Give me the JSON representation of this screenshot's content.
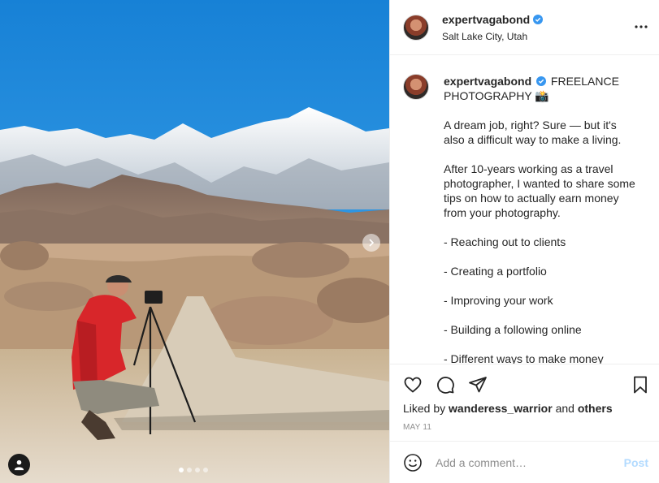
{
  "post": {
    "username": "expertvagabond",
    "location": "Salt Lake City, Utah",
    "verified": true
  },
  "caption": {
    "username": "expertvagabond",
    "title": "FREELANCE PHOTOGRAPHY 📸",
    "paragraphs": [
      "A dream job, right? Sure — but it's also a difficult way to make a living.",
      "After 10-years working as a travel photographer, I wanted to share some tips on how to actually earn money from your photography.",
      "- Reaching out to clients",
      "- Creating a portfolio",
      "- Improving your work",
      "- Building a following online",
      "- Different ways to make money"
    ]
  },
  "actions": {
    "liked_by_prefix": "Liked by",
    "liked_by_user": "wanderess_warrior",
    "liked_by_and": "and",
    "liked_by_others": "others",
    "date": "MAY 11"
  },
  "comment": {
    "placeholder": "Add a comment…",
    "post_label": "Post"
  },
  "carousel": {
    "slide_count": 4,
    "active_slide": 1
  },
  "icons": {
    "verified": "verified-badge-icon",
    "more": "more-options-icon",
    "like": "heart-icon",
    "comment": "comment-icon",
    "share": "paper-plane-icon",
    "save": "bookmark-icon",
    "emoji": "smiley-icon",
    "next": "chevron-right-icon",
    "tag": "user-tag-icon"
  },
  "colors": {
    "verified_blue": "#3897f0",
    "post_disabled": "#b3dbff",
    "muted_text": "#8e8e8e",
    "border": "#efefef"
  }
}
